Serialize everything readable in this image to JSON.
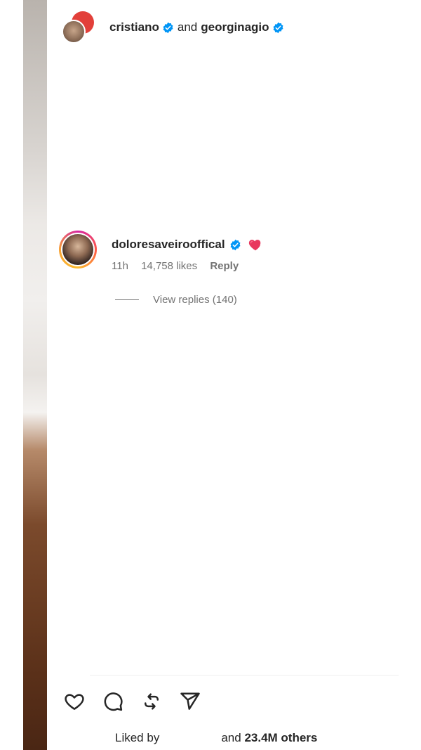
{
  "header": {
    "user1": "cristiano",
    "connector": "and",
    "user2": "georginagio"
  },
  "comment": {
    "username": "doloresaveirooffical",
    "emoji": "❤️",
    "time": "11h",
    "likes": "14,758 likes",
    "reply_label": "Reply",
    "view_replies": "View replies (140)"
  },
  "footer": {
    "liked_by_label": "Liked by",
    "and_label": "and",
    "others": "23.4M others"
  },
  "icons": {
    "like": "heart-icon",
    "comment": "comment-icon",
    "repost": "repost-icon",
    "share": "share-icon",
    "verified": "verified-badge-icon"
  },
  "colors": {
    "verified": "#0095f6",
    "text": "#262626",
    "secondary": "#737373"
  }
}
